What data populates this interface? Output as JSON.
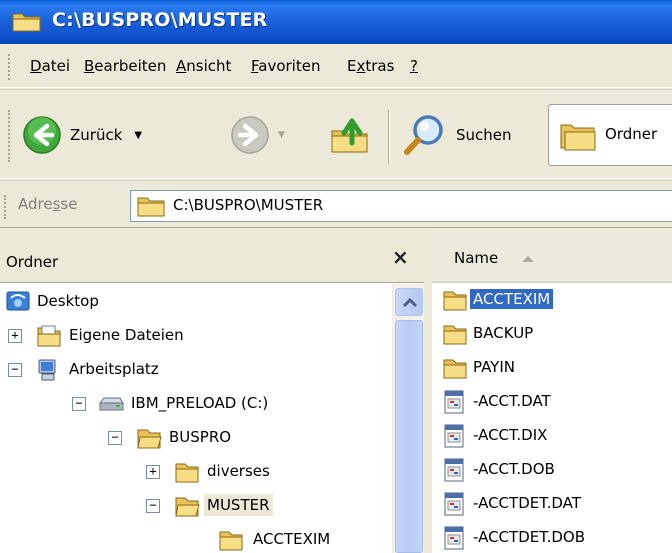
{
  "window": {
    "title": "C:\\BUSPRO\\MUSTER"
  },
  "menubar": {
    "items": [
      {
        "pre": "",
        "u": "D",
        "post": "atei"
      },
      {
        "pre": "",
        "u": "B",
        "post": "earbeiten"
      },
      {
        "pre": "",
        "u": "A",
        "post": "nsicht"
      },
      {
        "pre": "",
        "u": "F",
        "post": "avoriten"
      },
      {
        "pre": "E",
        "u": "x",
        "post": "tras"
      },
      {
        "pre": "",
        "u": "?",
        "post": ""
      }
    ]
  },
  "toolbar": {
    "back_label": "Zurück",
    "search_label": "Suchen",
    "folders_label": "Ordner"
  },
  "address": {
    "label_pre": "Adre",
    "label_u": "s",
    "label_post": "se",
    "value": "C:\\BUSPRO\\MUSTER"
  },
  "tree": {
    "title": "Ordner",
    "close_glyph": "×",
    "nodes": [
      {
        "label": "Desktop",
        "icon": "desktop-icon",
        "expander": ""
      },
      {
        "label": "Eigene Dateien",
        "icon": "my-documents-icon",
        "expander": "+"
      },
      {
        "label": "Arbeitsplatz",
        "icon": "my-computer-icon",
        "expander": "−"
      },
      {
        "label": "IBM_PRELOAD (C:)",
        "icon": "drive-icon",
        "expander": "−"
      },
      {
        "label": "BUSPRO",
        "icon": "folder-open-icon",
        "expander": "−"
      },
      {
        "label": "diverses",
        "icon": "folder-icon",
        "expander": "+"
      },
      {
        "label": "MUSTER",
        "icon": "folder-open-icon",
        "expander": "−"
      },
      {
        "label": "ACCTEXIM",
        "icon": "folder-icon",
        "expander": ""
      }
    ]
  },
  "filelist": {
    "column_name": "Name",
    "files": [
      {
        "name": "ACCTEXIM",
        "type": "folder"
      },
      {
        "name": "BACKUP",
        "type": "folder"
      },
      {
        "name": "PAYIN",
        "type": "folder"
      },
      {
        "name": "-ACCT.DAT",
        "type": "file"
      },
      {
        "name": "-ACCT.DIX",
        "type": "file"
      },
      {
        "name": "-ACCT.DOB",
        "type": "file"
      },
      {
        "name": "-ACCTDET.DAT",
        "type": "file"
      },
      {
        "name": "-ACCTDET.DOB",
        "type": "file"
      }
    ]
  },
  "colors": {
    "titlebar": "#0d4fc9",
    "selection": "#316ac5",
    "folder": "#f3d26a"
  }
}
